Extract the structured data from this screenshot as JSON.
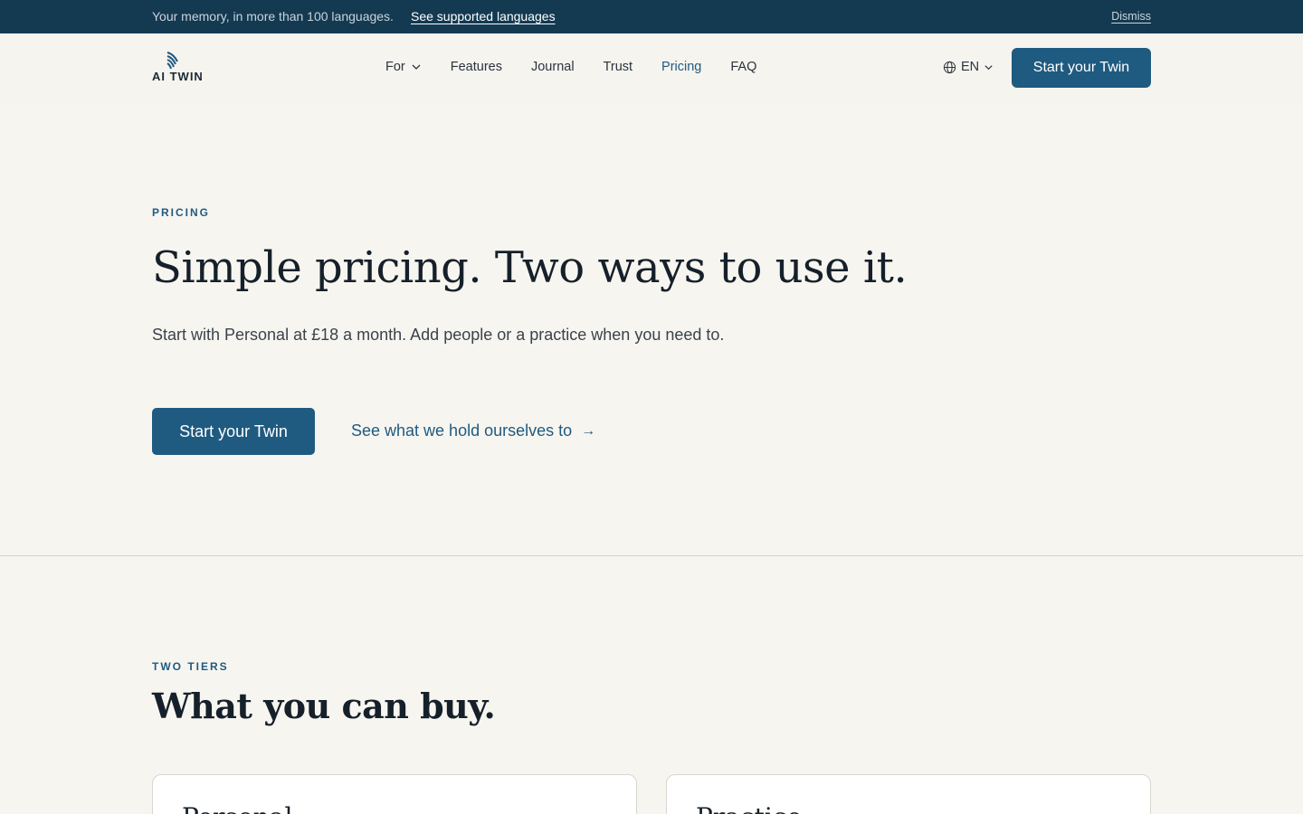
{
  "announcement": {
    "message": "Your memory, in more than 100 languages.",
    "link": "See supported languages",
    "dismiss": "Dismiss"
  },
  "header": {
    "logo_text": "AI TWIN",
    "nav": [
      {
        "label": "For",
        "has_dropdown": true,
        "icon": "chevron-down-icon"
      },
      {
        "label": "Features"
      },
      {
        "label": "Journal"
      },
      {
        "label": "Trust"
      },
      {
        "label": "Pricing",
        "active": true
      },
      {
        "label": "FAQ"
      }
    ],
    "language": {
      "value": "EN",
      "icon": "globe-icon"
    },
    "cta": "Start your Twin"
  },
  "hero": {
    "eyebrow": "PRICING",
    "title": "Simple pricing. Two ways to use it.",
    "subtitle": "Start with Personal at £18 a month. Add people or a practice when you need to.",
    "cta": "Start your Twin",
    "link": "See what we hold ourselves to",
    "link_arrow": "→"
  },
  "tiers": {
    "eyebrow": "TWO TIERS",
    "title": "What you can buy.",
    "cards": [
      {
        "title": "Personal"
      },
      {
        "title": "Practice"
      }
    ]
  },
  "colors": {
    "accent": "#1f5a80",
    "announcement_bg": "#143a52",
    "page_bg": "#f7f5f0"
  }
}
